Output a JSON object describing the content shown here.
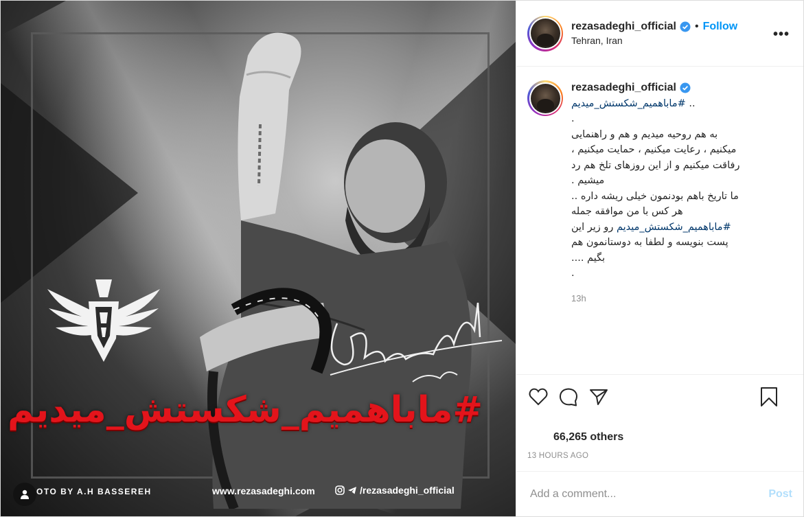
{
  "media": {
    "hashtag_art": "#ماباهمیم_شکستش_میدیم",
    "photo_credit": "OTO BY A.H BASSEREH",
    "website": "www.rezasadeghi.com",
    "social_handle": "/rezasadeghi_official"
  },
  "header": {
    "username": "rezasadeghi_official",
    "separator": "•",
    "follow_label": "Follow",
    "location": "Tehran, Iran",
    "more_label": "•••"
  },
  "caption": {
    "username": "rezasadeghi_official",
    "lines": [
      {
        "text": ".. ",
        "hashtag": "#ماباهمیم_شکستش_میدیم"
      },
      {
        "text": "."
      },
      {
        "text": "به هم روحیه میدیم و هم و راهنمایی"
      },
      {
        "text": "میکنیم ، رعایت میکنیم ، حمایت میکنیم ،"
      },
      {
        "text": "رفاقت میکنیم و از این روزهای تلخ هم رد"
      },
      {
        "text": "میشیم ."
      },
      {
        "text": "ما تاریخ باهم بودنمون خیلی ریشه داره .."
      },
      {
        "text": "هر کس با من موافقه جمله"
      },
      {
        "hashtag": "#ماباهمیم_شکستش_میدیم",
        "text": " رو زیر این"
      },
      {
        "text": "پست بنویسه و لطفا به دوستانمون هم"
      },
      {
        "text": "بگیم ...."
      },
      {
        "text": "."
      }
    ],
    "time": "13h"
  },
  "stats": {
    "likes": "66,265 others",
    "posted_ago": "13 HOURS AGO"
  },
  "comment_box": {
    "placeholder": "Add a comment...",
    "post_label": "Post"
  },
  "colors": {
    "accent": "#0095f6",
    "hashtag_link": "#00376b",
    "art_red": "#e3141b"
  }
}
